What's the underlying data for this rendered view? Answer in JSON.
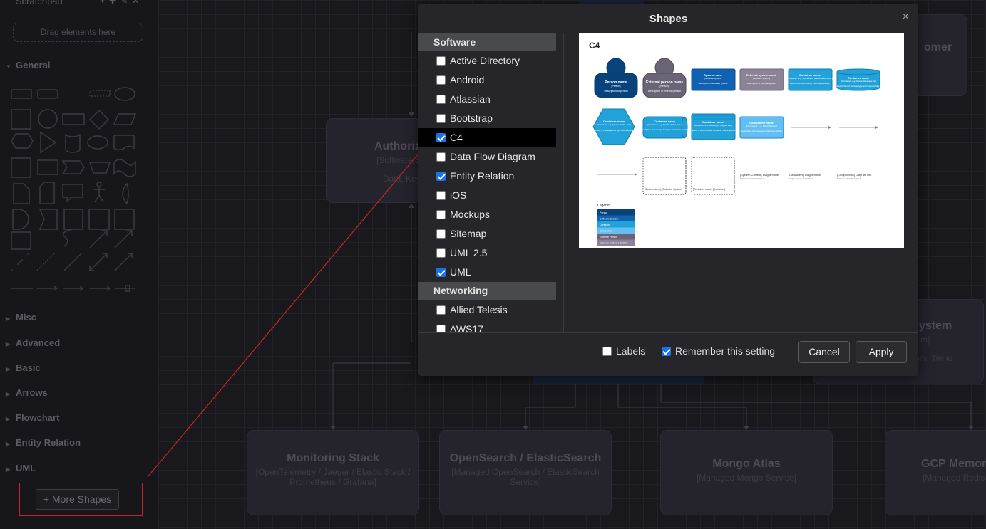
{
  "sidebar": {
    "title": "Scratchpad",
    "drag_hint": "Drag elements here",
    "sections": [
      "General",
      "Misc",
      "Advanced",
      "Basic",
      "Arrows",
      "Flowchart",
      "Entity Relation",
      "UML"
    ],
    "more_shapes": "More Shapes",
    "more_shapes_plus": "+"
  },
  "canvas": {
    "nodes": [
      {
        "title": "Authoriz",
        "sub": "[Software S",
        "extra": "Data, Key"
      },
      {
        "title": "omer",
        "sub": "",
        "extra": ""
      },
      {
        "title": "ystem",
        "sub": "m]",
        "extra": "rom, Twilio"
      },
      {
        "title": "Monitoring Stack",
        "sub": "[OpenTelemetry / Jaeger / Elastic Stack / Prometheus / Grafana]",
        "extra": ""
      },
      {
        "title": "OpenSearch / ElasticSearch",
        "sub": "[Managed OpenSearch / ElasticSearch Service]",
        "extra": ""
      },
      {
        "title": "Mongo Atlas",
        "sub": "[Managed Mongo Service]",
        "extra": ""
      },
      {
        "title": "GCP Memor",
        "sub": "[Managed Redis",
        "extra": ""
      }
    ]
  },
  "dialog": {
    "title": "Shapes",
    "close": "×",
    "categories": [
      {
        "name": "Software",
        "items": [
          {
            "label": "Active Directory",
            "checked": false,
            "selected": false
          },
          {
            "label": "Android",
            "checked": false,
            "selected": false
          },
          {
            "label": "Atlassian",
            "checked": false,
            "selected": false
          },
          {
            "label": "Bootstrap",
            "checked": false,
            "selected": false
          },
          {
            "label": "C4",
            "checked": true,
            "selected": true
          },
          {
            "label": "Data Flow Diagram",
            "checked": false,
            "selected": false
          },
          {
            "label": "Entity Relation",
            "checked": true,
            "selected": false
          },
          {
            "label": "iOS",
            "checked": false,
            "selected": false
          },
          {
            "label": "Mockups",
            "checked": false,
            "selected": false
          },
          {
            "label": "Sitemap",
            "checked": false,
            "selected": false
          },
          {
            "label": "UML 2.5",
            "checked": false,
            "selected": false
          },
          {
            "label": "UML",
            "checked": true,
            "selected": false
          }
        ]
      },
      {
        "name": "Networking",
        "items": [
          {
            "label": "Allied Telesis",
            "checked": false,
            "selected": false
          },
          {
            "label": "AWS17",
            "checked": false,
            "selected": false
          }
        ]
      }
    ],
    "preview": {
      "title": "C4",
      "person": {
        "title": "Person name",
        "sub": "[Person]",
        "desc": "Description of person"
      },
      "ext_person": {
        "title": "External person name",
        "sub": "[Person]",
        "desc": "Description of external person"
      },
      "system": {
        "title": "System name",
        "sub": "[Software System]",
        "desc": "Description of software system"
      },
      "ext_system": {
        "title": "External system name",
        "sub": "[Software System]",
        "desc": "Description of external system"
      },
      "container": {
        "title": "Container name",
        "sub": "[Container: e.g. SpringBoot, ElasticSearch, etc.]",
        "desc": "Description of container role/responsibility."
      },
      "database": {
        "title": "Container name",
        "sub": "[Container: e.g. Oracle Database 12]",
        "desc": "Description of storage type and responsibility."
      },
      "hex": {
        "title": "Container name",
        "sub": "[Container: e.g. Apache Kafka, etc.]",
        "desc": "Description of message bus type and responsibility."
      },
      "queue": {
        "title": "Container name",
        "sub": "[Container: e.g. Apache Kafka, etc.]",
        "desc": "Description of message bus type and responsibility."
      },
      "webbrowser": {
        "title": "Container name",
        "sub": "[Container: e.g. JavaScript, Angular etc.]",
        "desc": "Description of web browser container role/responsibility."
      },
      "component": {
        "title": "Component name",
        "sub": "[Component: e.g. Spring Service]",
        "desc": "Description of component role/responsibility."
      },
      "boundary_system": "[System name]\n[Software System]",
      "boundary_container": "[Container name]\n[Container]",
      "diagram_titles": [
        "[System Context] Diagram title",
        "[Containers] Diagram title",
        "[Components] Diagram title"
      ],
      "diagram_sub": "Diagram short description",
      "legend_title": "Legend",
      "legend_items": [
        "Person",
        "Software System",
        "Container",
        "Component",
        "External Person",
        "External Software System"
      ]
    },
    "labels_option": "Labels",
    "remember_option": "Remember this setting",
    "labels_checked": false,
    "remember_checked": true,
    "cancel": "Cancel",
    "apply": "Apply"
  },
  "colors": {
    "annotation_red": "#c72626",
    "c4_person": "#08427b",
    "c4_external": "#6b6477",
    "c4_system": "#1061b0",
    "c4_container": "#23a2d9",
    "c4_component": "#63bef2",
    "checkbox_blue": "#1a73e8"
  }
}
